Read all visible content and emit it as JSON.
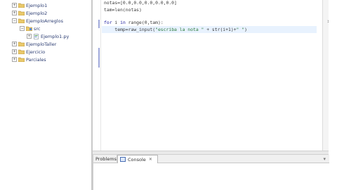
{
  "explorer": {
    "items": [
      {
        "label": "Ejemplo1",
        "expander": "+",
        "icon": "project-folder-icon",
        "indent": 0
      },
      {
        "label": "Ejemplo2",
        "expander": "+",
        "icon": "project-folder-icon",
        "indent": 0
      },
      {
        "label": "EjemploArreglos",
        "expander": "−",
        "icon": "project-folder-icon",
        "indent": 0
      },
      {
        "label": "src",
        "expander": "−",
        "icon": "source-folder-icon",
        "indent": 1
      },
      {
        "label": "Ejemplo1.py",
        "expander": "+",
        "icon": "python-file-icon",
        "indent": 2
      },
      {
        "label": "EjemploTaller",
        "expander": "+",
        "icon": "project-folder-icon",
        "indent": 0
      },
      {
        "label": "Ejercicio",
        "expander": "+",
        "icon": "project-folder-icon",
        "indent": 0
      },
      {
        "label": "Parciales",
        "expander": "+",
        "icon": "project-folder-icon",
        "indent": 0
      }
    ]
  },
  "editor": {
    "lines": [
      "notas=[0.0,0.0,0.0,0.0,0.0]",
      "tam=len(notas)",
      "",
      "for i in range(0,tam):",
      "    temp=raw_input(\"escriba la nota \" + str(i+1)+\" \")"
    ]
  },
  "bottom_view": {
    "tabs": [
      {
        "label": "Problems"
      },
      {
        "label": "Console",
        "close": "✕"
      }
    ],
    "view_menu": "▾"
  },
  "colors": {
    "keyword": "#1a1a9e",
    "string": "#2a7a3a",
    "current_line": "#e8f2fe",
    "tree_text": "#2d3e73"
  }
}
